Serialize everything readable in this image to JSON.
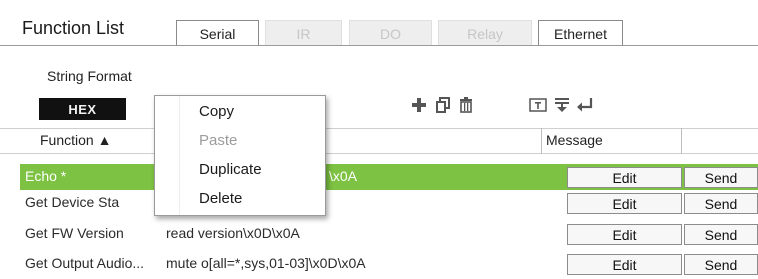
{
  "header": {
    "title": "Function List",
    "tabs": [
      {
        "label": "Serial",
        "enabled": true
      },
      {
        "label": "IR",
        "enabled": false
      },
      {
        "label": "DO",
        "enabled": false
      },
      {
        "label": "Relay",
        "enabled": false
      },
      {
        "label": "Ethernet",
        "enabled": true
      }
    ]
  },
  "string_format": {
    "label": "String Format",
    "value": "HEX"
  },
  "toolbar": {
    "icons": [
      "add-icon",
      "copy-icon",
      "delete-icon",
      "text-box-icon",
      "insert-icon",
      "enter-icon"
    ]
  },
  "columns": {
    "function": "Function ▲",
    "message": "Message"
  },
  "rows": [
    {
      "function": "Echo *",
      "message": "\\x0A",
      "edit": "Edit",
      "send": "Send",
      "selected": true
    },
    {
      "function": "Get Device Sta",
      "message": "",
      "edit": "Edit",
      "send": "Send",
      "selected": false
    },
    {
      "function": "Get FW Version",
      "message": "read version\\x0D\\x0A",
      "edit": "Edit",
      "send": "Send",
      "selected": false
    },
    {
      "function": "Get Output Audio...",
      "message": "mute o[all=*,sys,01-03]\\x0D\\x0A",
      "edit": "Edit",
      "send": "Send",
      "selected": false
    }
  ],
  "context_menu": {
    "items": [
      {
        "label": "Copy",
        "enabled": true
      },
      {
        "label": "Paste",
        "enabled": false
      },
      {
        "label": "Duplicate",
        "enabled": true
      },
      {
        "label": "Delete",
        "enabled": true
      }
    ]
  },
  "colors": {
    "selected_row": "#7dc242",
    "hex_button": "#111111"
  }
}
